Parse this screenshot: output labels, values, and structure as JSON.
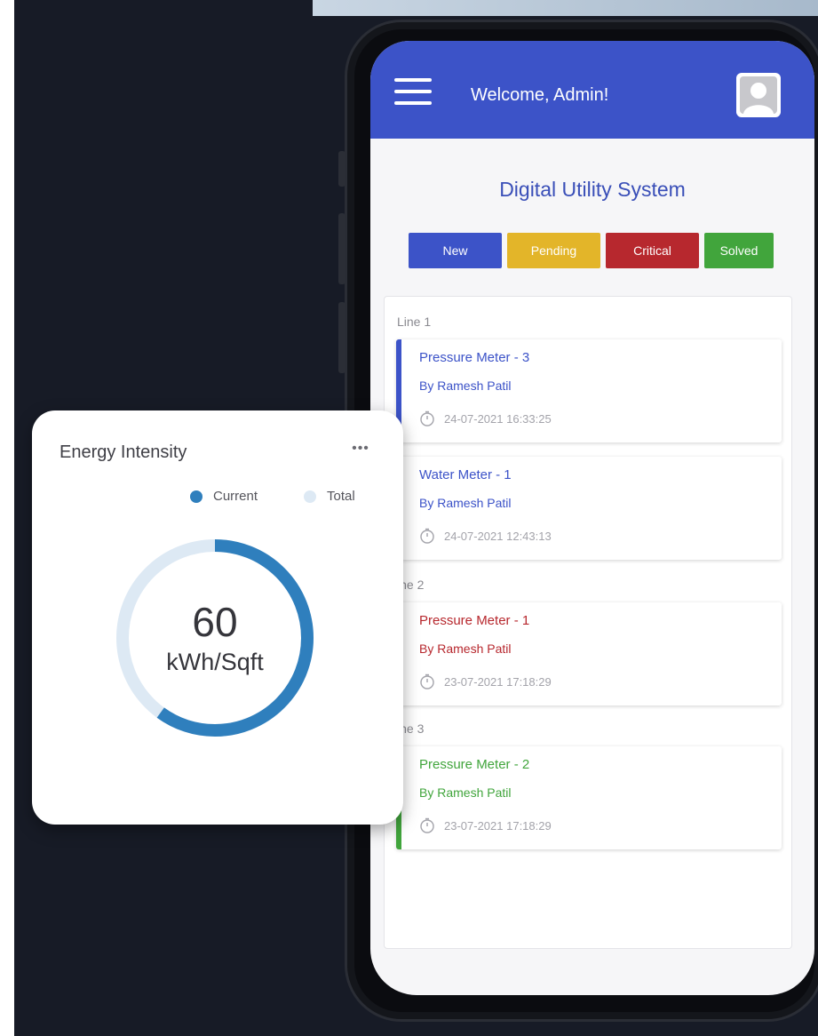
{
  "header": {
    "welcome": "Welcome, Admin!"
  },
  "app": {
    "title": "Digital Utility System"
  },
  "filters": [
    {
      "label": "New",
      "color": "#3c53c8"
    },
    {
      "label": "Pending",
      "color": "#e3b529"
    },
    {
      "label": "Critical",
      "color": "#b7282e"
    },
    {
      "label": "Solved",
      "color": "#41a53c"
    }
  ],
  "groups": [
    "Line 1",
    "ine 2",
    "ine 3"
  ],
  "tickets": [
    {
      "title": "Pressure Meter - 3",
      "by": "By Ramesh Patil",
      "time": "24-07-2021 16:33:25",
      "color": "#3c53c8"
    },
    {
      "title": "Water Meter - 1",
      "by": "By Ramesh Patil",
      "time": "24-07-2021 12:43:13",
      "color": "#3c53c8"
    },
    {
      "title": "Pressure Meter - 1",
      "by": "By Ramesh Patil",
      "time": "23-07-2021 17:18:29",
      "color": "#b7282e"
    },
    {
      "title": "Pressure Meter - 2",
      "by": "By Ramesh Patil",
      "time": "23-07-2021 17:18:29",
      "color": "#41a53c"
    }
  ],
  "energy": {
    "title": "Energy Intensity",
    "more": "•••",
    "legend": [
      {
        "label": "Current",
        "color": "#2f7fbd"
      },
      {
        "label": "Total",
        "color": "#dde9f4"
      }
    ],
    "value": "60",
    "unit": "kWh/Sqft",
    "current_fraction": 0.6
  }
}
